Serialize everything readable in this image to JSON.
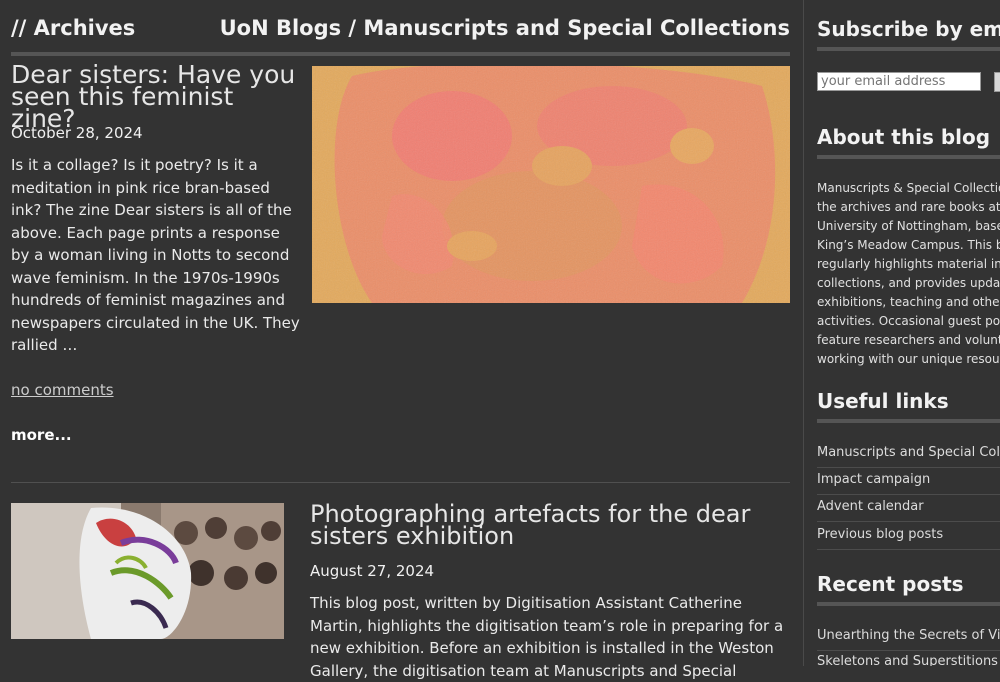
{
  "header": {
    "archives": "// Archives",
    "breadcrumb": "UoN Blogs / Manuscripts and Special Collections"
  },
  "posts": [
    {
      "title": "Dear sisters: Have you seen this feminist zine?",
      "date": "October 28, 2024",
      "excerpt": "Is it a collage? Is it poetry? Is it a meditation in pink rice bran-based ink? The zine Dear sisters is all of the above. Each page prints a response by a woman living in Notts to second wave feminism. In the 1970s-1990s hundreds of feminist magazines and newspapers circulated in the UK. They rallied …",
      "comments": "no comments",
      "more": "more..."
    },
    {
      "title": "Photographing artefacts for the dear sisters exhibition",
      "date": "August 27, 2024",
      "excerpt": "This blog post, written by Digitisation Assistant Catherine Martin, highlights the digitisation team’s role in preparing for a new exhibition. Before an exhibition is installed in the Weston Gallery, the digitisation team at Manuscripts and Special"
    }
  ],
  "sidebar": {
    "subscribe_title": "Subscribe by email",
    "email_placeholder": "your email address",
    "about_title": "About this blog",
    "about_lines": [
      "Manuscripts & Special Collections",
      "the archives and rare books at the",
      "University of Nottingham, based at",
      "King’s Meadow Campus. This blog",
      "regularly highlights material in our",
      "collections, and provides updates on",
      "exhibitions, teaching and other",
      "activities. Occasional guest posts",
      "feature researchers and volunteers",
      "working with our unique resources."
    ],
    "useful_title": "Useful links",
    "useful_links": [
      "Manuscripts and Special Collections",
      "Impact campaign",
      "Advent calendar",
      "Previous blog posts"
    ],
    "recent_title": "Recent posts",
    "recent_links": [
      "Unearthing the Secrets of Victorian",
      "Skeletons and Superstitions"
    ]
  },
  "colors": {
    "background": "#333333",
    "rule": "#555555",
    "zine_bg": "#e3a95c",
    "zine_ink": "#ef7f6e"
  }
}
